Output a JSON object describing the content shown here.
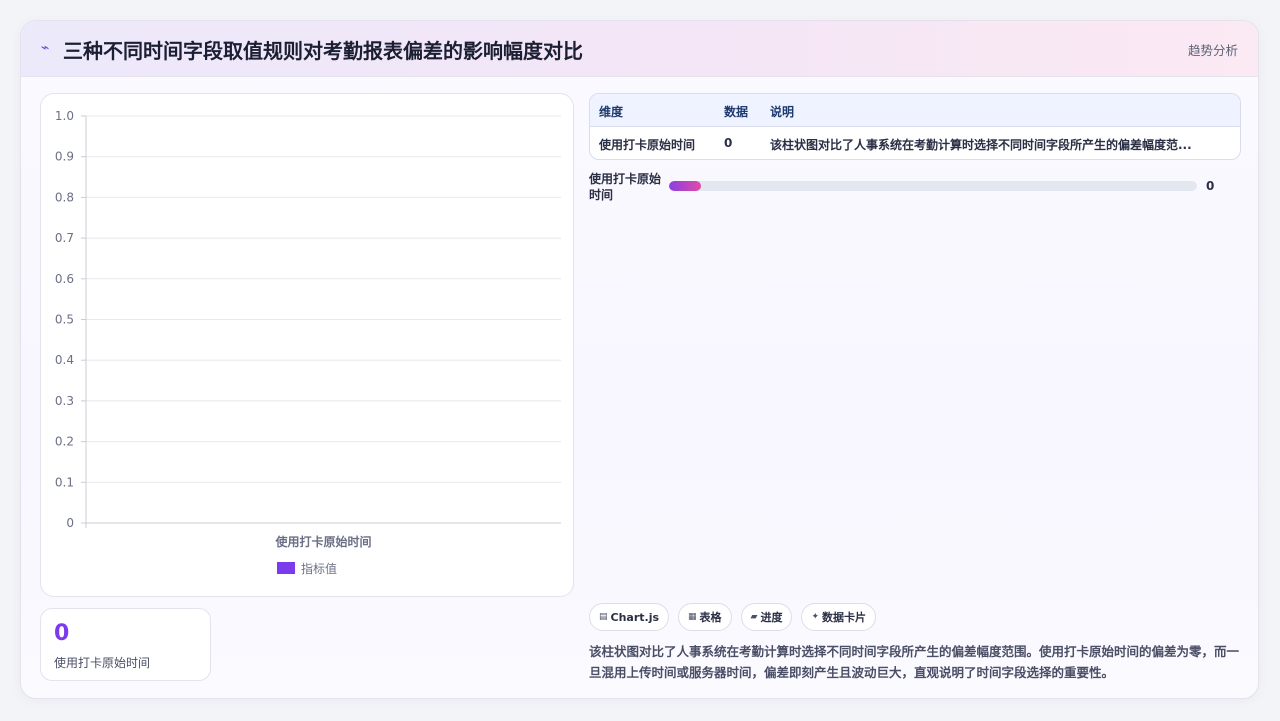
{
  "header": {
    "icon": "trend-icon",
    "title": "三种不同时间字段取值规则对考勤报表偏差的影响幅度对比",
    "tag": "趋势分析"
  },
  "chart_data": {
    "type": "bar",
    "categories": [
      "使用打卡原始时间"
    ],
    "series": [
      {
        "name": "指标值",
        "values": [
          0
        ],
        "color": "#7c3aed"
      }
    ],
    "ylim": [
      0,
      1.0
    ],
    "yticks": [
      "0",
      "0.1",
      "0.2",
      "0.3",
      "0.4",
      "0.5",
      "0.6",
      "0.7",
      "0.8",
      "0.9",
      "1.0"
    ],
    "grid": true,
    "legend": "bottom"
  },
  "stat": {
    "value": "0",
    "label": "使用打卡原始时间"
  },
  "table": {
    "headers": [
      "维度",
      "数据",
      "说明"
    ],
    "rows": [
      [
        "使用打卡原始时间",
        "0",
        "该柱状图对比了人事系统在考勤计算时选择不同时间字段所产生的偏差幅度范..."
      ]
    ]
  },
  "progress": {
    "label": "使用打卡原始时间",
    "value": "0",
    "fraction": 0
  },
  "chips": [
    {
      "icon": "chart-icon",
      "glyph": "▤",
      "label": "Chart.js"
    },
    {
      "icon": "table-icon",
      "glyph": "▦",
      "label": "表格"
    },
    {
      "icon": "progress-icon",
      "glyph": "▰",
      "label": "进度"
    },
    {
      "icon": "sparkle-icon",
      "glyph": "✦",
      "label": "数据卡片"
    }
  ],
  "description": "该柱状图对比了人事系统在考勤计算时选择不同时间字段所产生的偏差幅度范围。使用打卡原始时间的偏差为零，而一旦混用上传时间或服务器时间，偏差即刻产生且波动巨大，直观说明了时间字段选择的重要性。"
}
